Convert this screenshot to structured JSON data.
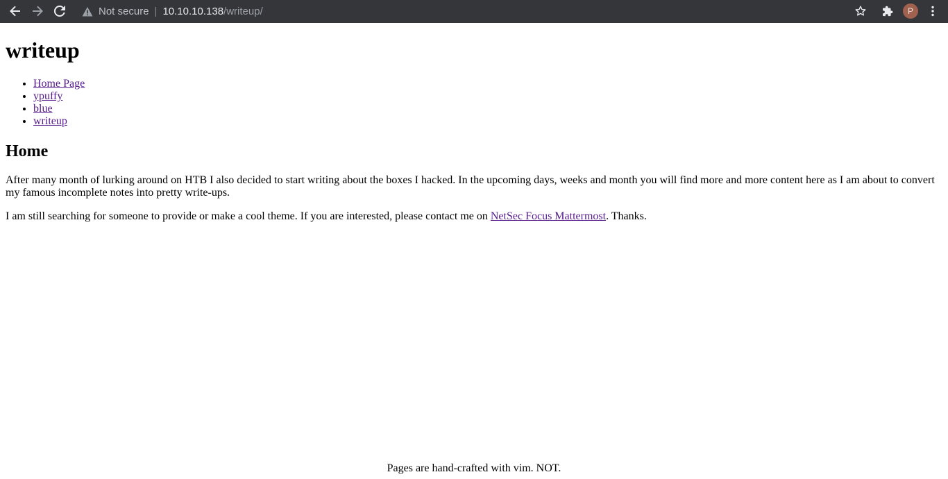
{
  "browser": {
    "security_label": "Not secure",
    "separator": "|",
    "url_host": "10.10.10.138",
    "url_path": "/writeup/",
    "profile_initial": "P",
    "icons": {
      "back": "arrow-left-icon",
      "forward": "arrow-right-icon",
      "reload": "reload-icon",
      "warning": "warning-triangle-icon",
      "bookmark": "star-icon",
      "extensions": "puzzle-icon",
      "menu": "kebab-menu-icon"
    },
    "colors": {
      "toolbar": "#35363a",
      "avatar": "#a0614f"
    }
  },
  "page": {
    "title": "writeup",
    "nav": [
      {
        "label": "Home Page"
      },
      {
        "label": "ypuffy"
      },
      {
        "label": "blue"
      },
      {
        "label": "writeup"
      }
    ],
    "section_title": "Home",
    "paragraph1": "After many month of lurking around on HTB I also decided to start writing about the boxes I hacked. In the upcoming days, weeks and month you will find more and more content here as I am about to convert my famous incomplete notes into pretty write-ups.",
    "paragraph2_before": "I am still searching for someone to provide or make a cool theme. If you are interested, please contact me on ",
    "paragraph2_link": "NetSec Focus Mattermost",
    "paragraph2_after": ". Thanks.",
    "footer": "Pages are hand-crafted with vim. NOT.",
    "colors": {
      "visited_link": "#551a8b",
      "text": "#000000",
      "background": "#ffffff"
    }
  }
}
